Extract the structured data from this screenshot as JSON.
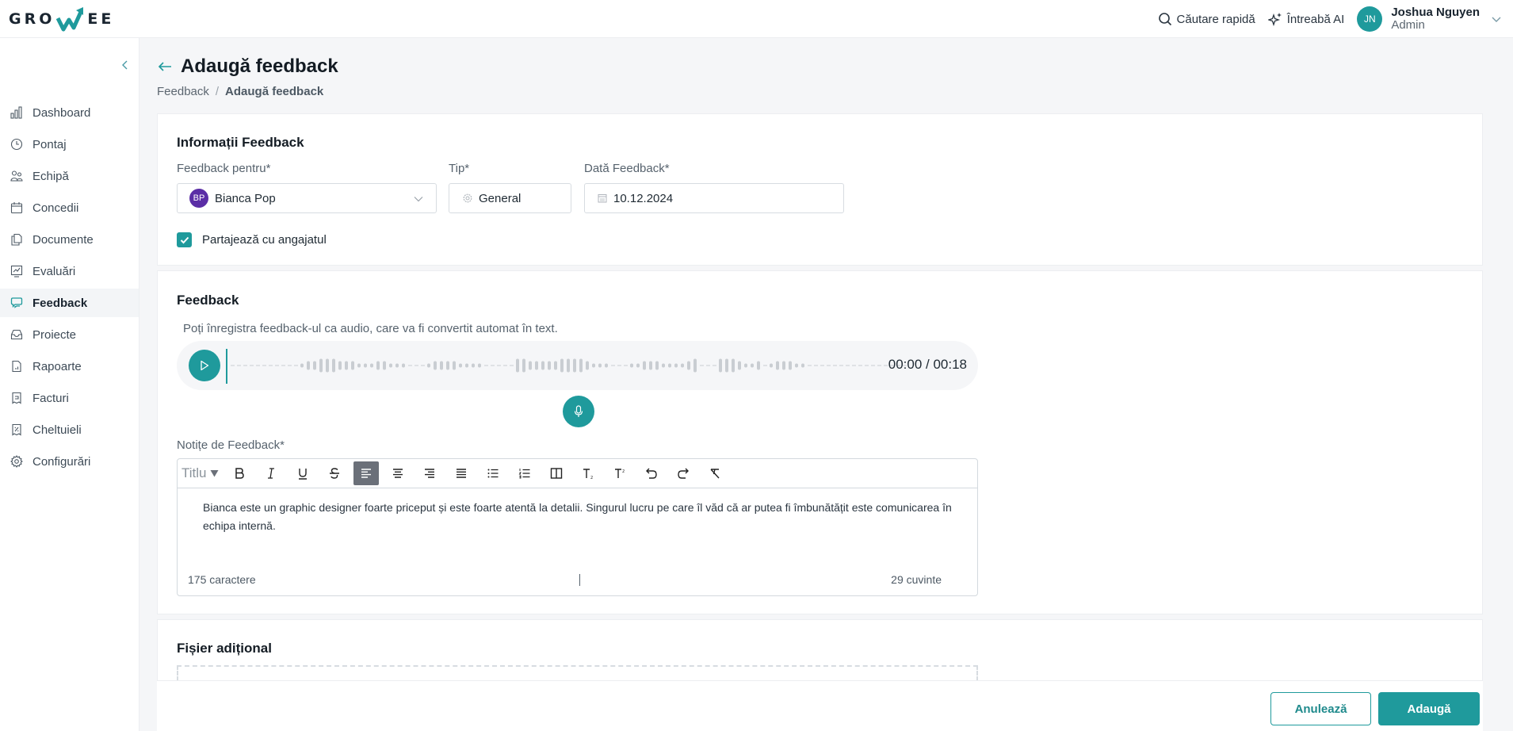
{
  "app": {
    "logo_left": "GRO",
    "logo_right": "EE",
    "brand_color": "#1f9a9c"
  },
  "topbar": {
    "search_label": "Căutare rapidă",
    "ai_label": "Întreabă AI",
    "user": {
      "initials": "JN",
      "name": "Joshua Nguyen",
      "role": "Admin"
    }
  },
  "sidebar": {
    "items": [
      {
        "label": "Dashboard",
        "icon": "bar-chart-icon",
        "active": false
      },
      {
        "label": "Pontaj",
        "icon": "clock-icon",
        "active": false
      },
      {
        "label": "Echipă",
        "icon": "users-icon",
        "active": false
      },
      {
        "label": "Concedii",
        "icon": "calendar-icon",
        "active": false
      },
      {
        "label": "Documente",
        "icon": "documents-icon",
        "active": false
      },
      {
        "label": "Evaluări",
        "icon": "evaluation-icon",
        "active": false
      },
      {
        "label": "Feedback",
        "icon": "chat-bubbles-icon",
        "active": true
      },
      {
        "label": "Proiecte",
        "icon": "inbox-icon",
        "active": false
      },
      {
        "label": "Rapoarte",
        "icon": "report-icon",
        "active": false
      },
      {
        "label": "Facturi",
        "icon": "invoice-icon",
        "active": false
      },
      {
        "label": "Cheltuieli",
        "icon": "expense-icon",
        "active": false
      },
      {
        "label": "Configurări",
        "icon": "gear-icon",
        "active": false
      }
    ]
  },
  "page": {
    "title": "Adaugă feedback",
    "breadcrumb": [
      "Feedback",
      "Adaugă feedback"
    ],
    "breadcrumb_sep": "/"
  },
  "info_section": {
    "title": "Informații Feedback",
    "feedback_for": {
      "label": "Feedback pentru*",
      "value": "Bianca Pop",
      "initials": "BP"
    },
    "type": {
      "label": "Tip*",
      "value": "General"
    },
    "date": {
      "label": "Dată Feedback*",
      "value": "10.12.2024"
    },
    "share": {
      "label": "Partajează cu angajatul",
      "checked": true
    }
  },
  "feedback_section": {
    "title": "Feedback",
    "hint": "Poți înregistra feedback-ul ca audio, care va fi convertit automat în text.",
    "audio": {
      "current": "00:00",
      "total": "00:18",
      "time_display": "00:00 / 00:18",
      "progress": 0
    },
    "notes_label": "Notițe de Feedback*",
    "toolbar": {
      "heading_select": "Titlu",
      "buttons": [
        "bold",
        "italic",
        "underline",
        "strikethrough",
        "align-left",
        "align-center",
        "align-right",
        "align-justify",
        "bullet-list",
        "numbered-list",
        "table",
        "subscript",
        "superscript",
        "undo",
        "redo",
        "clear-format"
      ],
      "active": "align-left"
    },
    "notes_text": "Bianca este un graphic designer foarte priceput și este foarte atentă la detalii. Singurul lucru pe care îl văd că ar putea fi  îmbunătățit este comunicarea în echipa internă.",
    "char_count": "175 caractere",
    "word_count": "29 cuvinte"
  },
  "file_section": {
    "title": "Fișier adițional"
  },
  "actions": {
    "cancel": "Anulează",
    "submit": "Adaugă"
  }
}
